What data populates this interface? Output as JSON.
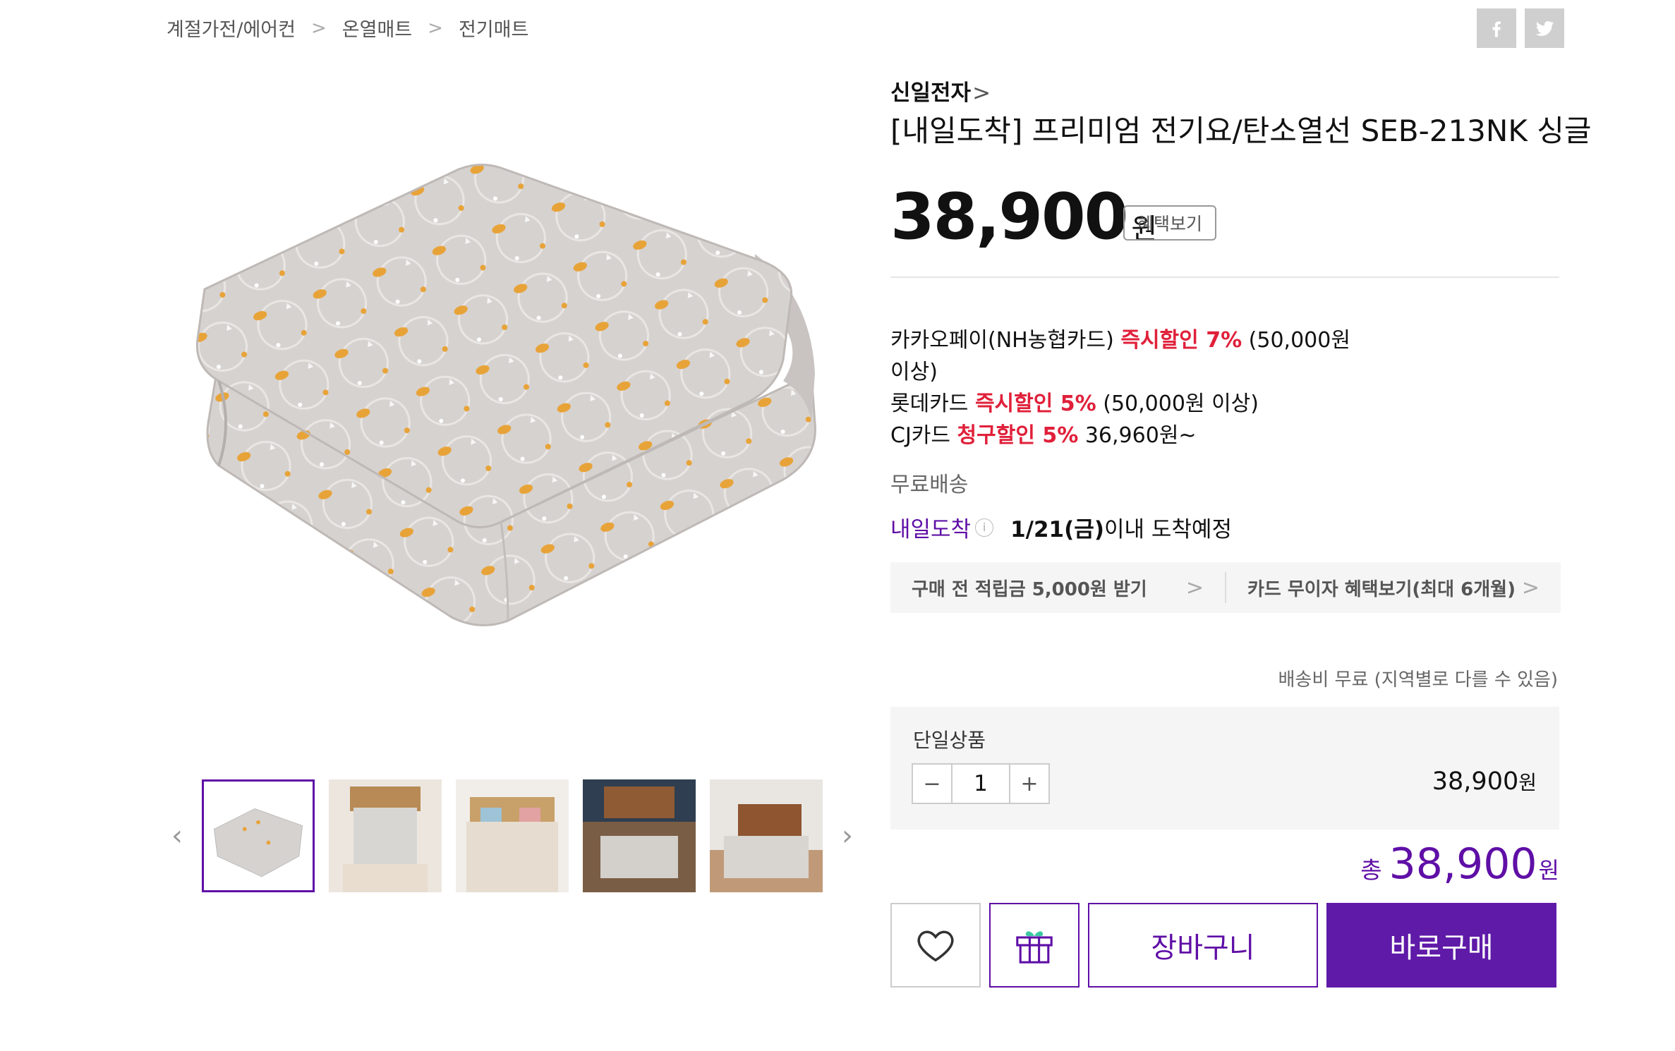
{
  "breadcrumb": [
    "계절가전/에어컨",
    "온열매트",
    "전기매트"
  ],
  "breadcrumb_sep": ">",
  "share": {
    "facebook": "facebook-icon",
    "twitter": "twitter-icon"
  },
  "product": {
    "brand": "신일전자",
    "brand_chevron": ">",
    "title": "[내일도착] 프리미엄 전기요/탄소열선 SEB-213NK 싱글",
    "price": "38,900",
    "currency": "원",
    "benefit_button": "혜택보기"
  },
  "card_benefits": [
    {
      "prefix": "카카오페이(NH농협카드) ",
      "highlight": "즉시할인 7%",
      "suffix": " (50,000원 이상)"
    },
    {
      "prefix": "롯데카드 ",
      "highlight": "즉시할인 5%",
      "suffix": " (50,000원 이상)"
    },
    {
      "prefix": "CJ카드 ",
      "highlight": "청구할인 5%",
      "suffix": " 36,960원~"
    }
  ],
  "shipping": {
    "free": "무료배송",
    "arrival_tag": "내일도착",
    "arrival_date": "1/21(금)",
    "arrival_suffix": "이내 도착예정",
    "note": "배송비 무료 (지역별로 다를 수 있음)"
  },
  "promos": [
    {
      "label": "구매 전 적립금 5,000원 받기",
      "chevron": ">"
    },
    {
      "label": "카드 무이자 혜택보기(최대 6개월)",
      "chevron": ">"
    }
  ],
  "option": {
    "label": "단일상품",
    "minus": "−",
    "quantity": "1",
    "plus": "+",
    "price": "38,900",
    "currency": "원"
  },
  "total": {
    "label": "총",
    "price": "38,900",
    "currency": "원"
  },
  "actions": {
    "wish": "heart-icon",
    "gift": "gift-icon",
    "cart": "장바구니",
    "buy": "바로구매"
  },
  "gallery": {
    "prev": "‹",
    "next": "›",
    "thumb_count": 5,
    "active_index": 0
  },
  "colors": {
    "accent": "#5f0fa6",
    "discount_red": "#e0203a"
  }
}
